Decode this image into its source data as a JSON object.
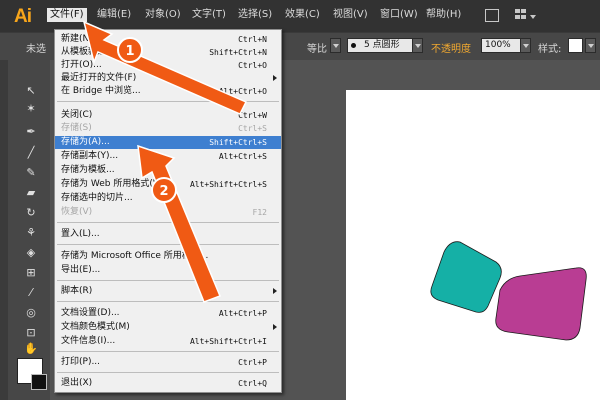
{
  "app": {
    "logo": "Ai"
  },
  "menubar": {
    "items": [
      {
        "label": "文件(F)"
      },
      {
        "label": "编辑(E)"
      },
      {
        "label": "对象(O)"
      },
      {
        "label": "文字(T)"
      },
      {
        "label": "选择(S)"
      },
      {
        "label": "效果(C)"
      },
      {
        "label": "视图(V)"
      },
      {
        "label": "窗口(W)"
      },
      {
        "label": "帮助(H)"
      }
    ]
  },
  "control_bar": {
    "left_label": "未选",
    "stroke_profile": "等比",
    "brush": "5 点圆形",
    "opacity_label": "不透明度",
    "opacity_value": "100%",
    "style_label": "样式:"
  },
  "file_menu": {
    "items": [
      {
        "label": "新建(N)...",
        "shortcut": "Ctrl+N"
      },
      {
        "label": "从模板新建(T)...",
        "shortcut": "Shift+Ctrl+N"
      },
      {
        "label": "打开(O)...",
        "shortcut": "Ctrl+O"
      },
      {
        "label": "最近打开的文件(F)",
        "shortcut": ""
      },
      {
        "label": "在 Bridge 中浏览...",
        "shortcut": "Alt+Ctrl+O"
      },
      {
        "label": "关闭(C)",
        "shortcut": "Ctrl+W"
      },
      {
        "label": "存储(S)",
        "shortcut": "Ctrl+S"
      },
      {
        "label": "存储为(A)...",
        "shortcut": "Shift+Ctrl+S"
      },
      {
        "label": "存储副本(Y)...",
        "shortcut": "Alt+Ctrl+S"
      },
      {
        "label": "存储为模板...",
        "shortcut": ""
      },
      {
        "label": "存储为 Web 所用格式(W)...",
        "shortcut": "Alt+Shift+Ctrl+S"
      },
      {
        "label": "存储选中的切片...",
        "shortcut": ""
      },
      {
        "label": "恢复(V)",
        "shortcut": "F12"
      },
      {
        "label": "置入(L)...",
        "shortcut": ""
      },
      {
        "label": "存储为 Microsoft Office 所用格式...",
        "shortcut": ""
      },
      {
        "label": "导出(E)...",
        "shortcut": ""
      },
      {
        "label": "脚本(R)",
        "shortcut": ""
      },
      {
        "label": "文档设置(D)...",
        "shortcut": "Alt+Ctrl+P"
      },
      {
        "label": "文档颜色模式(M)",
        "shortcut": ""
      },
      {
        "label": "文件信息(I)...",
        "shortcut": "Alt+Shift+Ctrl+I"
      },
      {
        "label": "打印(P)...",
        "shortcut": "Ctrl+P"
      },
      {
        "label": "退出(X)",
        "shortcut": "Ctrl+Q"
      }
    ]
  },
  "annotations": {
    "step1": "1",
    "step2": "2",
    "arrow_color": "#f05a14"
  },
  "colors": {
    "shape_teal": "#15b0a6",
    "shape_magenta": "#b93d93",
    "menu_highlight": "#3e7fd0"
  },
  "icons": [
    "illustrator-logo-icon",
    "arrange-documents-icon",
    "workspace-icon",
    "selection-tool-icon",
    "magic-wand-icon",
    "pen-tool-icon",
    "line-tool-icon",
    "brush-tool-icon",
    "rotate-tool-icon",
    "width-tool-icon",
    "eyedropper-icon",
    "hand-tool-icon"
  ]
}
